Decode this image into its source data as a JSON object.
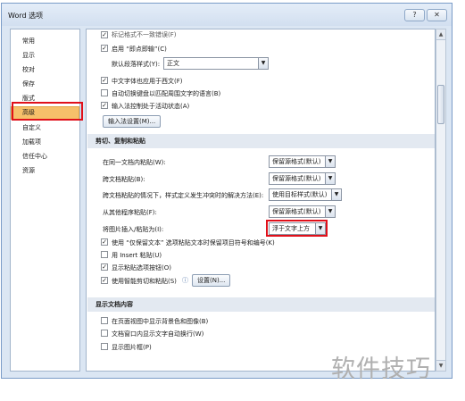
{
  "window": {
    "title": "Word 选项",
    "help_label": "?",
    "close_label": "✕"
  },
  "nav": {
    "items": [
      "常用",
      "显示",
      "校对",
      "保存",
      "版式",
      "高级",
      "自定义",
      "加载项",
      "信任中心",
      "资源"
    ],
    "selected": "高级"
  },
  "editing": {
    "partial_item": "标记格式不一致错误(F)",
    "smart_para_select": "启用 “即点即输”(C)",
    "default_para_style_label": "默认段落样式(Y):",
    "default_para_style_value": "正文",
    "chinese_font_west": "中文字体也应用于西文(F)",
    "auto_keyboard": "自动切换键盘以匹配周围文字的语言(B)",
    "ime_active": "输入法控制处于活动状态(A)",
    "ime_settings_button": "输入法设置(M)..."
  },
  "cut_copy_paste": {
    "header": "剪切、复制和粘贴",
    "within_doc_label": "在同一文档内粘贴(W):",
    "within_doc_value": "保留源格式(默认)",
    "between_docs_label": "跨文档粘贴(B):",
    "between_docs_value": "保留源格式(默认)",
    "conflict_label": "跨文档粘贴的情况下，样式定义发生冲突时的解决方法(E):",
    "conflict_value": "使用目标样式(默认)",
    "other_programs_label": "从其他程序粘贴(F):",
    "other_programs_value": "保留源格式(默认)",
    "insert_picture_label": "将图片插入/粘贴为(I):",
    "insert_picture_value": "浮于文字上方",
    "keep_bullets": "使用 “仅保留文本” 选项粘贴文本时保留项目符号和编号(K)",
    "use_insert_key": "用 Insert 粘贴(U)",
    "show_paste_options": "显示粘贴选项按钮(O)",
    "smart_cut_paste": "使用智能剪切和粘贴(S)",
    "settings_button": "设置(N)..."
  },
  "show_document": {
    "header": "显示文档内容",
    "bg_colors": "在页面视图中显示背景色和图像(B)",
    "wrap_text": "文档窗口内显示文字自动换行(W)",
    "picture_placeholders": "显示图片框(P)"
  },
  "watermark": {
    "text": "软件技巧"
  },
  "colors": {
    "selection": "#f6c06a",
    "highlight_border": "#e0101a",
    "section_bg": "#e3e9f1"
  },
  "icons": {
    "check": "✓",
    "dropdown": "▼",
    "scroll_up": "▲",
    "scroll_down": "▼",
    "info": "ⓘ"
  }
}
